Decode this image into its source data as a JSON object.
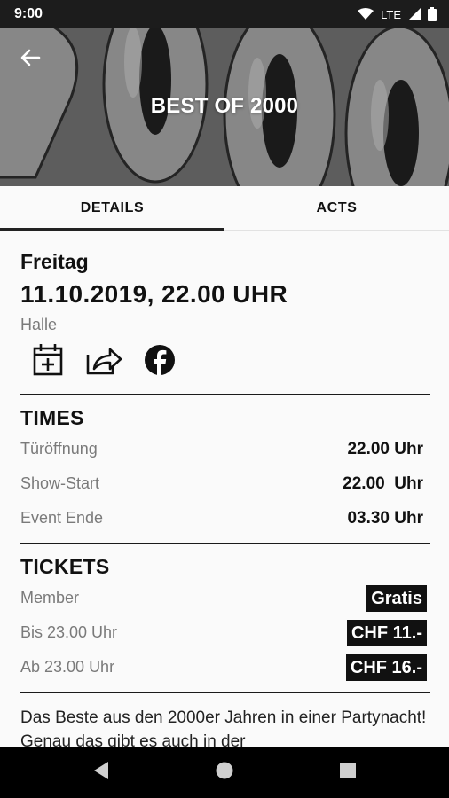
{
  "status_bar": {
    "time": "9:00",
    "network": "LTE"
  },
  "header": {
    "title": "BEST OF 2000",
    "background_text": "2000"
  },
  "tabs": [
    {
      "label": "DETAILS",
      "active": true
    },
    {
      "label": "ACTS",
      "active": false
    }
  ],
  "event": {
    "weekday": "Freitag",
    "datetime": "11.10.2019, 22.00 UHR",
    "venue": "Halle",
    "actions": [
      "calendar-add-icon",
      "share-icon",
      "facebook-icon"
    ]
  },
  "times": {
    "title": "TIMES",
    "rows": [
      {
        "label": "Türöffnung",
        "value": "22.00 Uhr"
      },
      {
        "label": "Show-Start",
        "value": "22.00  Uhr"
      },
      {
        "label": "Event Ende",
        "value": "03.30 Uhr"
      }
    ]
  },
  "tickets": {
    "title": "TICKETS",
    "rows": [
      {
        "label": "Member",
        "price": "Gratis"
      },
      {
        "label": "Bis 23.00 Uhr",
        "price": "CHF 11.-"
      },
      {
        "label": "Ab 23.00 Uhr",
        "price": "CHF 16.-"
      }
    ]
  },
  "description": "Das Beste aus den 2000er Jahren in einer Partynacht! Genau das gibt es auch in der",
  "colors": {
    "hero_bg": "#6d6d6d",
    "ink": "#111111",
    "muted": "#7a7a7a",
    "status_bar": "#1c1c1c",
    "nav_bar": "#000000"
  }
}
